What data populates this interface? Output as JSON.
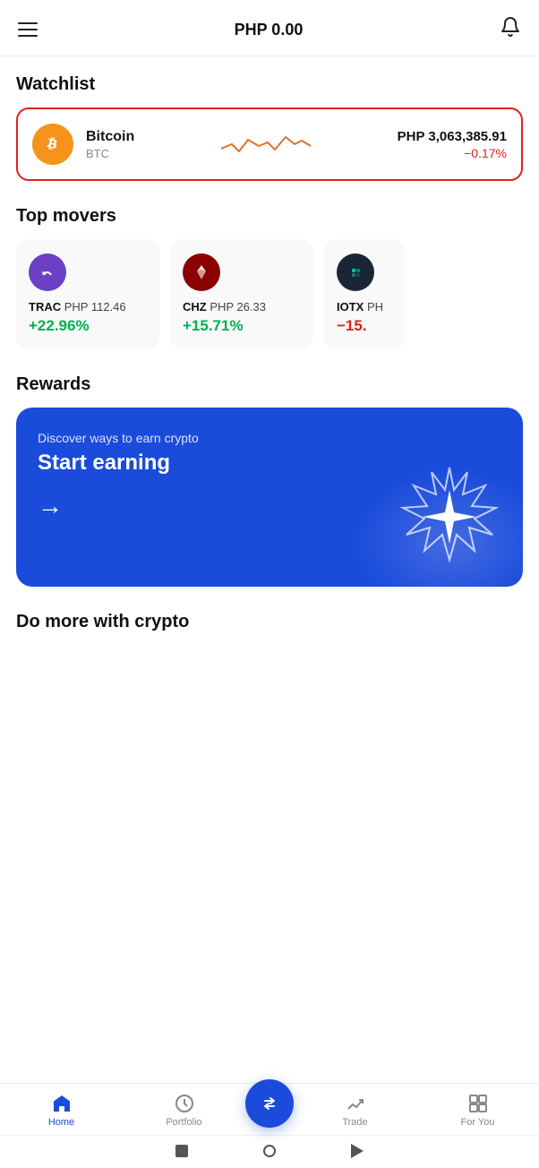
{
  "header": {
    "balance": "PHP 0.00",
    "menu_label": "menu",
    "bell_label": "bell"
  },
  "watchlist": {
    "section_title": "Watchlist",
    "item": {
      "name": "Bitcoin",
      "symbol": "BTC",
      "price": "PHP 3,063,385.91",
      "change": "−0.17%"
    }
  },
  "top_movers": {
    "section_title": "Top movers",
    "items": [
      {
        "symbol": "TRAC",
        "price": "PHP 112.46",
        "change": "+22.96%",
        "positive": true,
        "class": "trac"
      },
      {
        "symbol": "CHZ",
        "price": "PHP 26.33",
        "change": "+15.71%",
        "positive": true,
        "class": "chz"
      },
      {
        "symbol": "IOTX",
        "price": "PH",
        "change": "−15.",
        "positive": false,
        "class": "iotx",
        "partial": true
      }
    ]
  },
  "rewards": {
    "section_title": "Rewards",
    "subtitle": "Discover ways to earn crypto",
    "title": "Start earning",
    "arrow": "→"
  },
  "do_more": {
    "section_title": "Do more with crypto"
  },
  "bottom_nav": {
    "items": [
      {
        "label": "Home",
        "active": true,
        "icon": "🏠"
      },
      {
        "label": "Portfolio",
        "active": false,
        "icon": "🕐"
      },
      {
        "label": "",
        "active": false,
        "icon": "",
        "center": true
      },
      {
        "label": "Trade",
        "active": false,
        "icon": "📈"
      },
      {
        "label": "For You",
        "active": false,
        "icon": "▦"
      }
    ]
  },
  "android_nav": {
    "square": "■",
    "circle": "○",
    "back": "◀"
  }
}
